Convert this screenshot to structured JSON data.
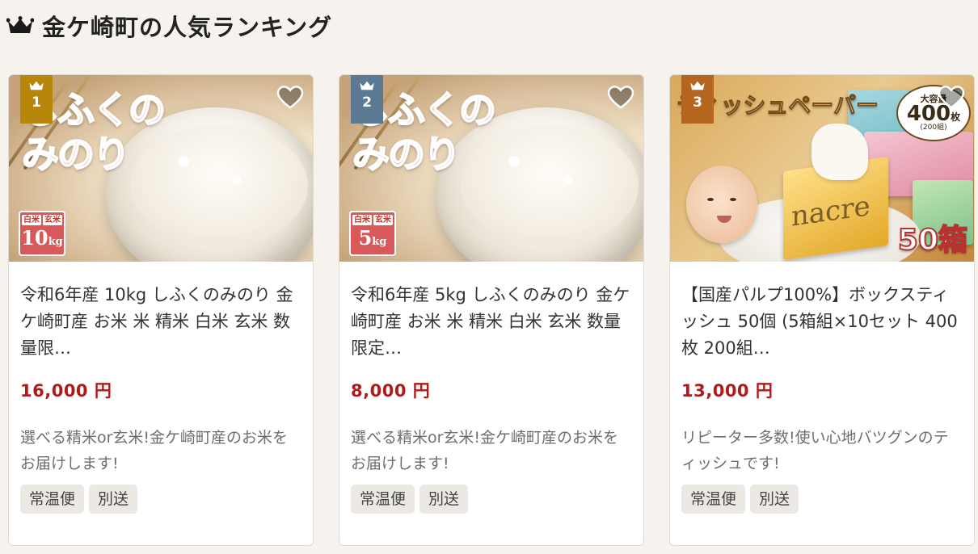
{
  "section": {
    "title": "金ケ崎町の人気ランキング",
    "icon": "crown-icon"
  },
  "products": [
    {
      "rank": "1",
      "rank_color": "#b8860b",
      "title": "令和6年産 10kg しふくのみのり 金ケ崎町産 お米 米 精米 白米 玄米 数量限…",
      "price": "16,000 円",
      "description": "選べる精米or玄米!金ケ崎町産のお米をお届けします!",
      "tags": [
        "常温便",
        "別送"
      ],
      "image": {
        "logo": "しふくのみのり",
        "tag_white": "白米",
        "tag_brown": "玄米",
        "weight": "10",
        "unit": "kg"
      }
    },
    {
      "rank": "2",
      "rank_color": "#5d7a94",
      "title": "令和6年産 5kg しふくのみのり 金ケ崎町産 お米 米 精米 白米 玄米 数量限定…",
      "price": "8,000 円",
      "description": "選べる精米or玄米!金ケ崎町産のお米をお届けします!",
      "tags": [
        "常温便",
        "別送"
      ],
      "image": {
        "logo": "しふくのみのり",
        "tag_white": "白米",
        "tag_brown": "玄米",
        "weight": "5",
        "unit": "kg"
      }
    },
    {
      "rank": "3",
      "rank_color": "#b5651d",
      "title": "【国産パルプ100%】ボックスティッシュ 50個 (5箱組×10セット 400枚 200組…",
      "price": "13,000 円",
      "description": "リピーター多数!使い心地バツグンのティッシュです!",
      "tags": [
        "常温便",
        "別送"
      ],
      "image": {
        "banner": "ティッシュペーパー",
        "capacity_label": "大容量",
        "capacity_num": "400",
        "capacity_unit": "枚",
        "capacity_sub": "(200組)",
        "brand": "nacre",
        "count": "50箱"
      }
    }
  ],
  "colors": {
    "price": "#b01a1a",
    "accent_weight": "#d9585a"
  }
}
